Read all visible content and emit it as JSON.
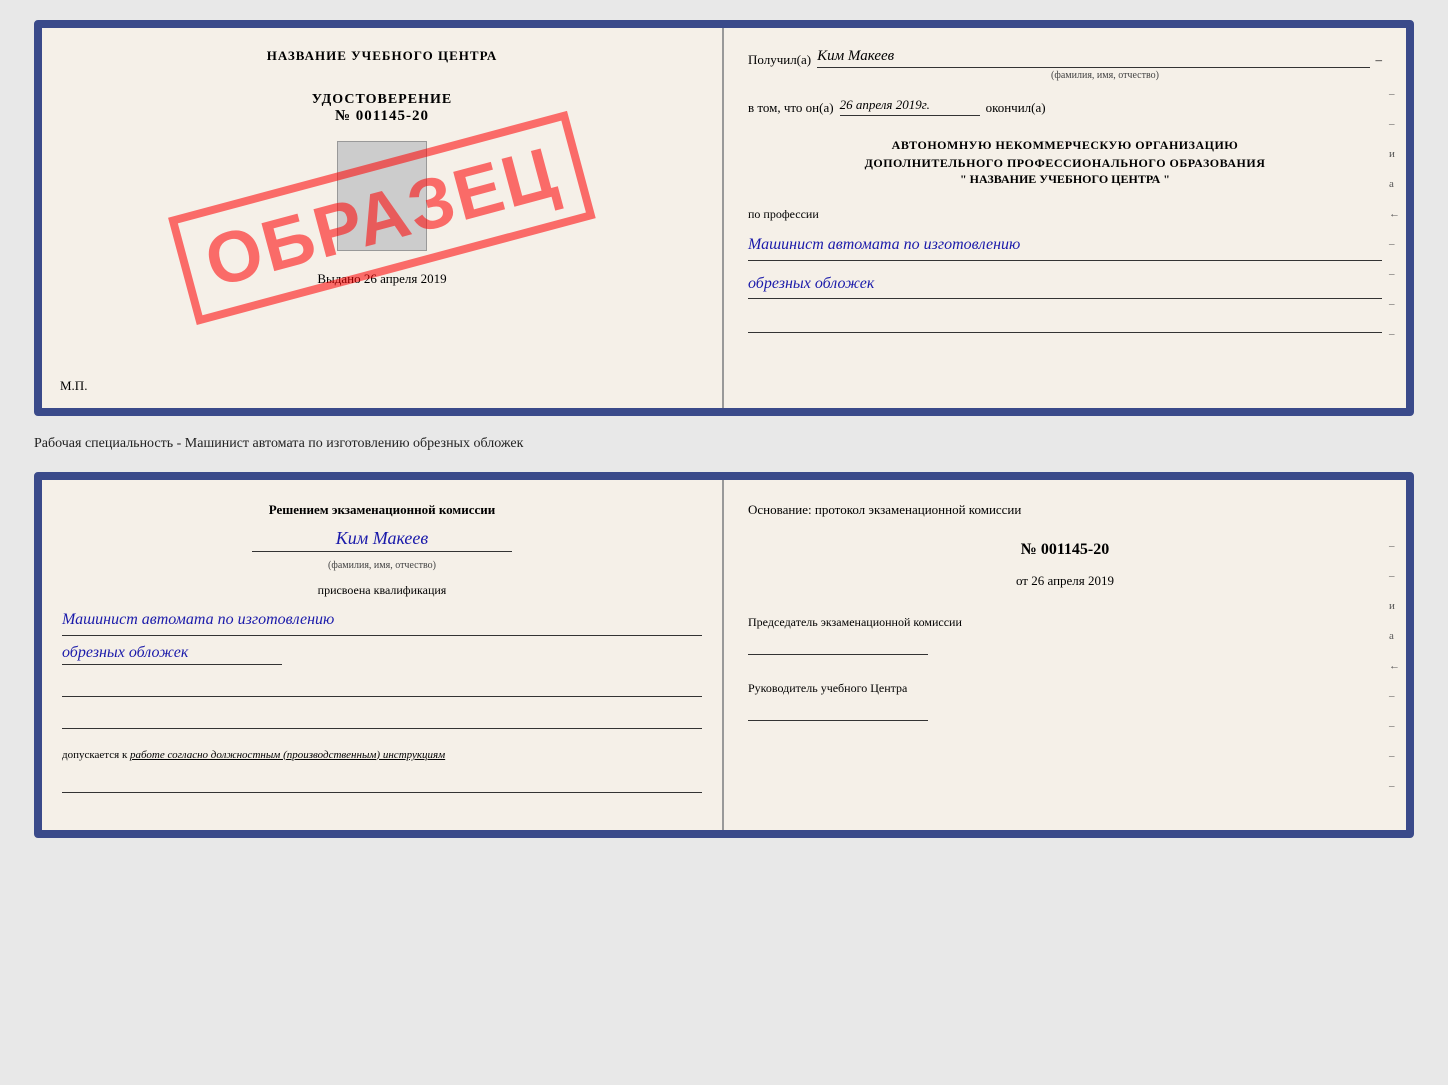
{
  "topDoc": {
    "left": {
      "title": "НАЗВАНИЕ УЧЕБНОГО ЦЕНТРА",
      "stamp": "ОБРАЗЕЦ",
      "udostLabel": "УДОСТОВЕРЕНИЕ",
      "udostNumber": "№ 001145-20",
      "vydano": "Выдано",
      "vydanoDate": "26 апреля 2019",
      "mp": "М.П."
    },
    "right": {
      "poluchilLabel": "Получил(а)",
      "recipientName": "Ким Макеев",
      "fioSub": "(фамилия, имя, отчество)",
      "dash": "–",
      "vtomLabel": "в том, что он(а)",
      "vtomDate": "26 апреля 2019г.",
      "okonchilLabel": "окончил(а)",
      "orgLine1": "АВТОНОМНУЮ НЕКОММЕРЧЕСКУЮ ОРГАНИЗАЦИЮ",
      "orgLine2": "ДОПОЛНИТЕЛЬНОГО ПРОФЕССИОНАЛЬНОГО ОБРАЗОВАНИЯ",
      "orgName": "\" НАЗВАНИЕ УЧЕБНОГО ЦЕНТРА \"",
      "proprofessiiLabel": "по профессии",
      "professionLine1": "Машинист автомата по изготовлению",
      "professionLine2": "обрезных обложек",
      "sideMarks": [
        "–",
        "–",
        "–",
        "и",
        "а",
        "←",
        "–",
        "–",
        "–",
        "–"
      ]
    }
  },
  "separator": {
    "text": "Рабочая специальность - Машинист автомата по изготовлению обрезных обложек"
  },
  "bottomDoc": {
    "left": {
      "resheniemText": "Решением экзаменационной комиссии",
      "fioName": "Ким Макеев",
      "fioSub": "(фамилия, имя, отчество)",
      "prisvoenLabel": "присвоена квалификация",
      "qualLine1": "Машинист автомата по изготовлению",
      "qualLine2": "обрезных обложек",
      "dopuskaetsiaText": "допускается к",
      "dopuskaetsiaItalic": "работе согласно должностным (производственным) инструкциям"
    },
    "right": {
      "osnovanieText": "Основание: протокол экзаменационной комиссии",
      "protocolNumber": "№ 001145-20",
      "otLabel": "от",
      "otDate": "26 апреля 2019",
      "predsedatelLabel": "Председатель экзаменационной комиссии",
      "rukovoditelLabel": "Руководитель учебного Центра",
      "sideMarks": [
        "–",
        "–",
        "–",
        "и",
        "а",
        "←",
        "–",
        "–",
        "–",
        "–"
      ]
    }
  }
}
